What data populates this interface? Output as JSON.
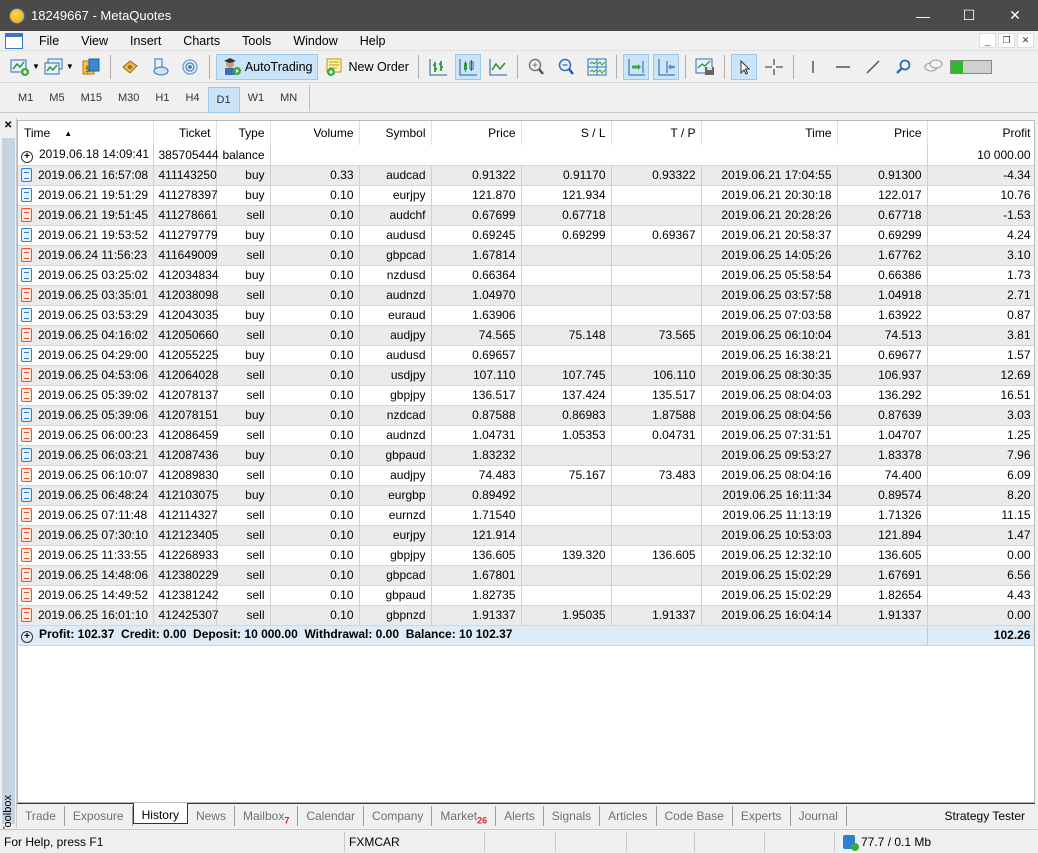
{
  "window": {
    "title": "18249667 - MetaQuotes",
    "controls": [
      "minimize",
      "maximize",
      "close"
    ]
  },
  "menu": [
    "File",
    "View",
    "Insert",
    "Charts",
    "Tools",
    "Window",
    "Help"
  ],
  "toolbar": {
    "autotrading_label": "AutoTrading",
    "new_order_label": "New Order"
  },
  "timeframes": {
    "items": [
      "M1",
      "M5",
      "M15",
      "M30",
      "H1",
      "H4",
      "D1",
      "W1",
      "MN"
    ],
    "selected": "D1"
  },
  "toolbox_label": "Toolbox",
  "table": {
    "columns": [
      "Time",
      "Ticket",
      "Type",
      "Volume",
      "Symbol",
      "Price",
      "S / L",
      "T / P",
      "Time",
      "Price",
      "Profit"
    ],
    "sort_column": "Time",
    "balance_row": {
      "time": "2019.06.18 14:09:41",
      "ticket": "385705444",
      "type": "balance",
      "profit": "10 000.00"
    },
    "rows": [
      {
        "t1": "2019.06.21 16:57:08",
        "ticket": "411143250",
        "type": "buy",
        "vol": "0.33",
        "sym": "audcad",
        "p1": "0.91322",
        "sl": "0.91170",
        "tp": "0.93322",
        "t2": "2019.06.21 17:04:55",
        "p2": "0.91300",
        "profit": "-4.34"
      },
      {
        "t1": "2019.06.21 19:51:29",
        "ticket": "411278397",
        "type": "buy",
        "vol": "0.10",
        "sym": "eurjpy",
        "p1": "121.870",
        "sl": "121.934",
        "tp": "",
        "t2": "2019.06.21 20:30:18",
        "p2": "122.017",
        "profit": "10.76"
      },
      {
        "t1": "2019.06.21 19:51:45",
        "ticket": "411278661",
        "type": "sell",
        "vol": "0.10",
        "sym": "audchf",
        "p1": "0.67699",
        "sl": "0.67718",
        "tp": "",
        "t2": "2019.06.21 20:28:26",
        "p2": "0.67718",
        "profit": "-1.53"
      },
      {
        "t1": "2019.06.21 19:53:52",
        "ticket": "411279779",
        "type": "buy",
        "vol": "0.10",
        "sym": "audusd",
        "p1": "0.69245",
        "sl": "0.69299",
        "tp": "0.69367",
        "t2": "2019.06.21 20:58:37",
        "p2": "0.69299",
        "profit": "4.24"
      },
      {
        "t1": "2019.06.24 11:56:23",
        "ticket": "411649009",
        "type": "sell",
        "vol": "0.10",
        "sym": "gbpcad",
        "p1": "1.67814",
        "sl": "",
        "tp": "",
        "t2": "2019.06.25 14:05:26",
        "p2": "1.67762",
        "profit": "3.10"
      },
      {
        "t1": "2019.06.25 03:25:02",
        "ticket": "412034834",
        "type": "buy",
        "vol": "0.10",
        "sym": "nzdusd",
        "p1": "0.66364",
        "sl": "",
        "tp": "",
        "t2": "2019.06.25 05:58:54",
        "p2": "0.66386",
        "profit": "1.73"
      },
      {
        "t1": "2019.06.25 03:35:01",
        "ticket": "412038098",
        "type": "sell",
        "vol": "0.10",
        "sym": "audnzd",
        "p1": "1.04970",
        "sl": "",
        "tp": "",
        "t2": "2019.06.25 03:57:58",
        "p2": "1.04918",
        "profit": "2.71"
      },
      {
        "t1": "2019.06.25 03:53:29",
        "ticket": "412043035",
        "type": "buy",
        "vol": "0.10",
        "sym": "euraud",
        "p1": "1.63906",
        "sl": "",
        "tp": "",
        "t2": "2019.06.25 07:03:58",
        "p2": "1.63922",
        "profit": "0.87"
      },
      {
        "t1": "2019.06.25 04:16:02",
        "ticket": "412050660",
        "type": "sell",
        "vol": "0.10",
        "sym": "audjpy",
        "p1": "74.565",
        "sl": "75.148",
        "tp": "73.565",
        "t2": "2019.06.25 06:10:04",
        "p2": "74.513",
        "profit": "3.81"
      },
      {
        "t1": "2019.06.25 04:29:00",
        "ticket": "412055225",
        "type": "buy",
        "vol": "0.10",
        "sym": "audusd",
        "p1": "0.69657",
        "sl": "",
        "tp": "",
        "t2": "2019.06.25 16:38:21",
        "p2": "0.69677",
        "profit": "1.57"
      },
      {
        "t1": "2019.06.25 04:53:06",
        "ticket": "412064028",
        "type": "sell",
        "vol": "0.10",
        "sym": "usdjpy",
        "p1": "107.110",
        "sl": "107.745",
        "tp": "106.110",
        "t2": "2019.06.25 08:30:35",
        "p2": "106.937",
        "profit": "12.69"
      },
      {
        "t1": "2019.06.25 05:39:02",
        "ticket": "412078137",
        "type": "sell",
        "vol": "0.10",
        "sym": "gbpjpy",
        "p1": "136.517",
        "sl": "137.424",
        "tp": "135.517",
        "t2": "2019.06.25 08:04:03",
        "p2": "136.292",
        "profit": "16.51"
      },
      {
        "t1": "2019.06.25 05:39:06",
        "ticket": "412078151",
        "type": "buy",
        "vol": "0.10",
        "sym": "nzdcad",
        "p1": "0.87588",
        "sl": "0.86983",
        "tp": "1.87588",
        "t2": "2019.06.25 08:04:56",
        "p2": "0.87639",
        "profit": "3.03"
      },
      {
        "t1": "2019.06.25 06:00:23",
        "ticket": "412086459",
        "type": "sell",
        "vol": "0.10",
        "sym": "audnzd",
        "p1": "1.04731",
        "sl": "1.05353",
        "tp": "0.04731",
        "t2": "2019.06.25 07:31:51",
        "p2": "1.04707",
        "profit": "1.25"
      },
      {
        "t1": "2019.06.25 06:03:21",
        "ticket": "412087436",
        "type": "buy",
        "vol": "0.10",
        "sym": "gbpaud",
        "p1": "1.83232",
        "sl": "",
        "tp": "",
        "t2": "2019.06.25 09:53:27",
        "p2": "1.83378",
        "profit": "7.96"
      },
      {
        "t1": "2019.06.25 06:10:07",
        "ticket": "412089830",
        "type": "sell",
        "vol": "0.10",
        "sym": "audjpy",
        "p1": "74.483",
        "sl": "75.167",
        "tp": "73.483",
        "t2": "2019.06.25 08:04:16",
        "p2": "74.400",
        "profit": "6.09"
      },
      {
        "t1": "2019.06.25 06:48:24",
        "ticket": "412103075",
        "type": "buy",
        "vol": "0.10",
        "sym": "eurgbp",
        "p1": "0.89492",
        "sl": "",
        "tp": "",
        "t2": "2019.06.25 16:11:34",
        "p2": "0.89574",
        "profit": "8.20"
      },
      {
        "t1": "2019.06.25 07:11:48",
        "ticket": "412114327",
        "type": "sell",
        "vol": "0.10",
        "sym": "eurnzd",
        "p1": "1.71540",
        "sl": "",
        "tp": "",
        "t2": "2019.06.25 11:13:19",
        "p2": "1.71326",
        "profit": "11.15"
      },
      {
        "t1": "2019.06.25 07:30:10",
        "ticket": "412123405",
        "type": "sell",
        "vol": "0.10",
        "sym": "eurjpy",
        "p1": "121.914",
        "sl": "",
        "tp": "",
        "t2": "2019.06.25 10:53:03",
        "p2": "121.894",
        "profit": "1.47"
      },
      {
        "t1": "2019.06.25 11:33:55",
        "ticket": "412268933",
        "type": "sell",
        "vol": "0.10",
        "sym": "gbpjpy",
        "p1": "136.605",
        "sl": "139.320",
        "tp": "136.605",
        "t2": "2019.06.25 12:32:10",
        "p2": "136.605",
        "profit": "0.00"
      },
      {
        "t1": "2019.06.25 14:48:06",
        "ticket": "412380229",
        "type": "sell",
        "vol": "0.10",
        "sym": "gbpcad",
        "p1": "1.67801",
        "sl": "",
        "tp": "",
        "t2": "2019.06.25 15:02:29",
        "p2": "1.67691",
        "profit": "6.56"
      },
      {
        "t1": "2019.06.25 14:49:52",
        "ticket": "412381242",
        "type": "sell",
        "vol": "0.10",
        "sym": "gbpaud",
        "p1": "1.82735",
        "sl": "",
        "tp": "",
        "t2": "2019.06.25 15:02:29",
        "p2": "1.82654",
        "profit": "4.43"
      },
      {
        "t1": "2019.06.25 16:01:10",
        "ticket": "412425307",
        "type": "sell",
        "vol": "0.10",
        "sym": "gbpnzd",
        "p1": "1.91337",
        "sl": "1.95035",
        "tp": "1.91337",
        "t2": "2019.06.25 16:04:14",
        "p2": "1.91337",
        "profit": "0.00"
      }
    ],
    "summary": {
      "text": "Profit: 102.37  Credit: 0.00  Deposit: 10 000.00  Withdrawal: 0.00  Balance: 10 102.37",
      "total": "102.26"
    }
  },
  "tabs": [
    {
      "label": "Trade"
    },
    {
      "label": "Exposure"
    },
    {
      "label": "History",
      "active": true
    },
    {
      "label": "News"
    },
    {
      "label": "Mailbox",
      "badge": "7"
    },
    {
      "label": "Calendar"
    },
    {
      "label": "Company"
    },
    {
      "label": "Market",
      "badge": "26"
    },
    {
      "label": "Alerts"
    },
    {
      "label": "Signals"
    },
    {
      "label": "Articles"
    },
    {
      "label": "Code Base"
    },
    {
      "label": "Experts"
    },
    {
      "label": "Journal"
    }
  ],
  "strategy_tester_label": "Strategy Tester",
  "status": {
    "help": "For Help, press F1",
    "profile": "FXMCAR",
    "traffic": "77.7 / 0.1 Mb"
  },
  "colors": {
    "buy": "#2e7fd0",
    "sell": "#e8532c",
    "selected": "#cce4f7",
    "summary_bg": "#ddecf9",
    "badge": "#e02020"
  }
}
